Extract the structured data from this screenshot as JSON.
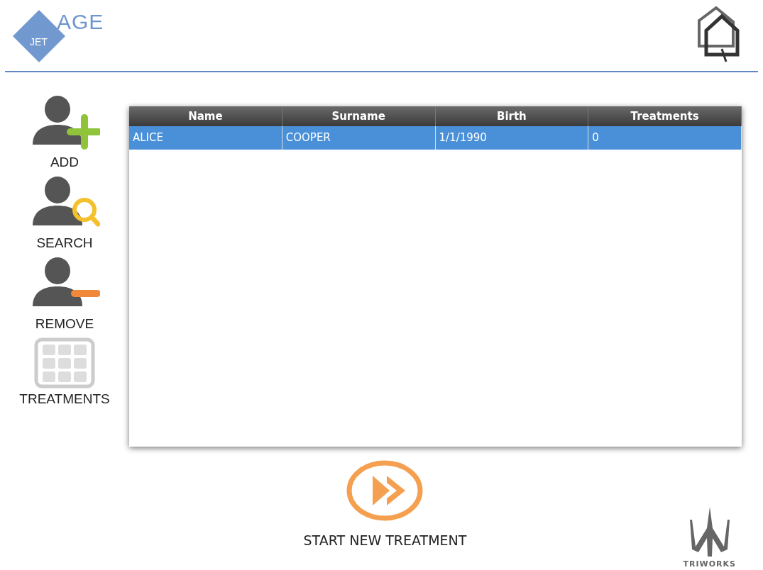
{
  "header": {
    "logo_top": "AGE",
    "logo_bottom": "JET"
  },
  "sidebar": {
    "items": [
      {
        "label": "ADD",
        "kind": "add"
      },
      {
        "label": "SEARCH",
        "kind": "search"
      },
      {
        "label": "REMOVE",
        "kind": "remove"
      },
      {
        "label": "TREATMENTS",
        "kind": "treatments"
      }
    ]
  },
  "table": {
    "columns": [
      "Name",
      "Surname",
      "Birth",
      "Treatments"
    ],
    "rows": [
      {
        "cells": [
          "ALICE",
          "COOPER",
          "1/1/1990",
          "0"
        ],
        "selected": true
      }
    ]
  },
  "start_button": {
    "label": "START NEW TREATMENT"
  },
  "footer": {
    "brand": "TRIWORKS"
  }
}
